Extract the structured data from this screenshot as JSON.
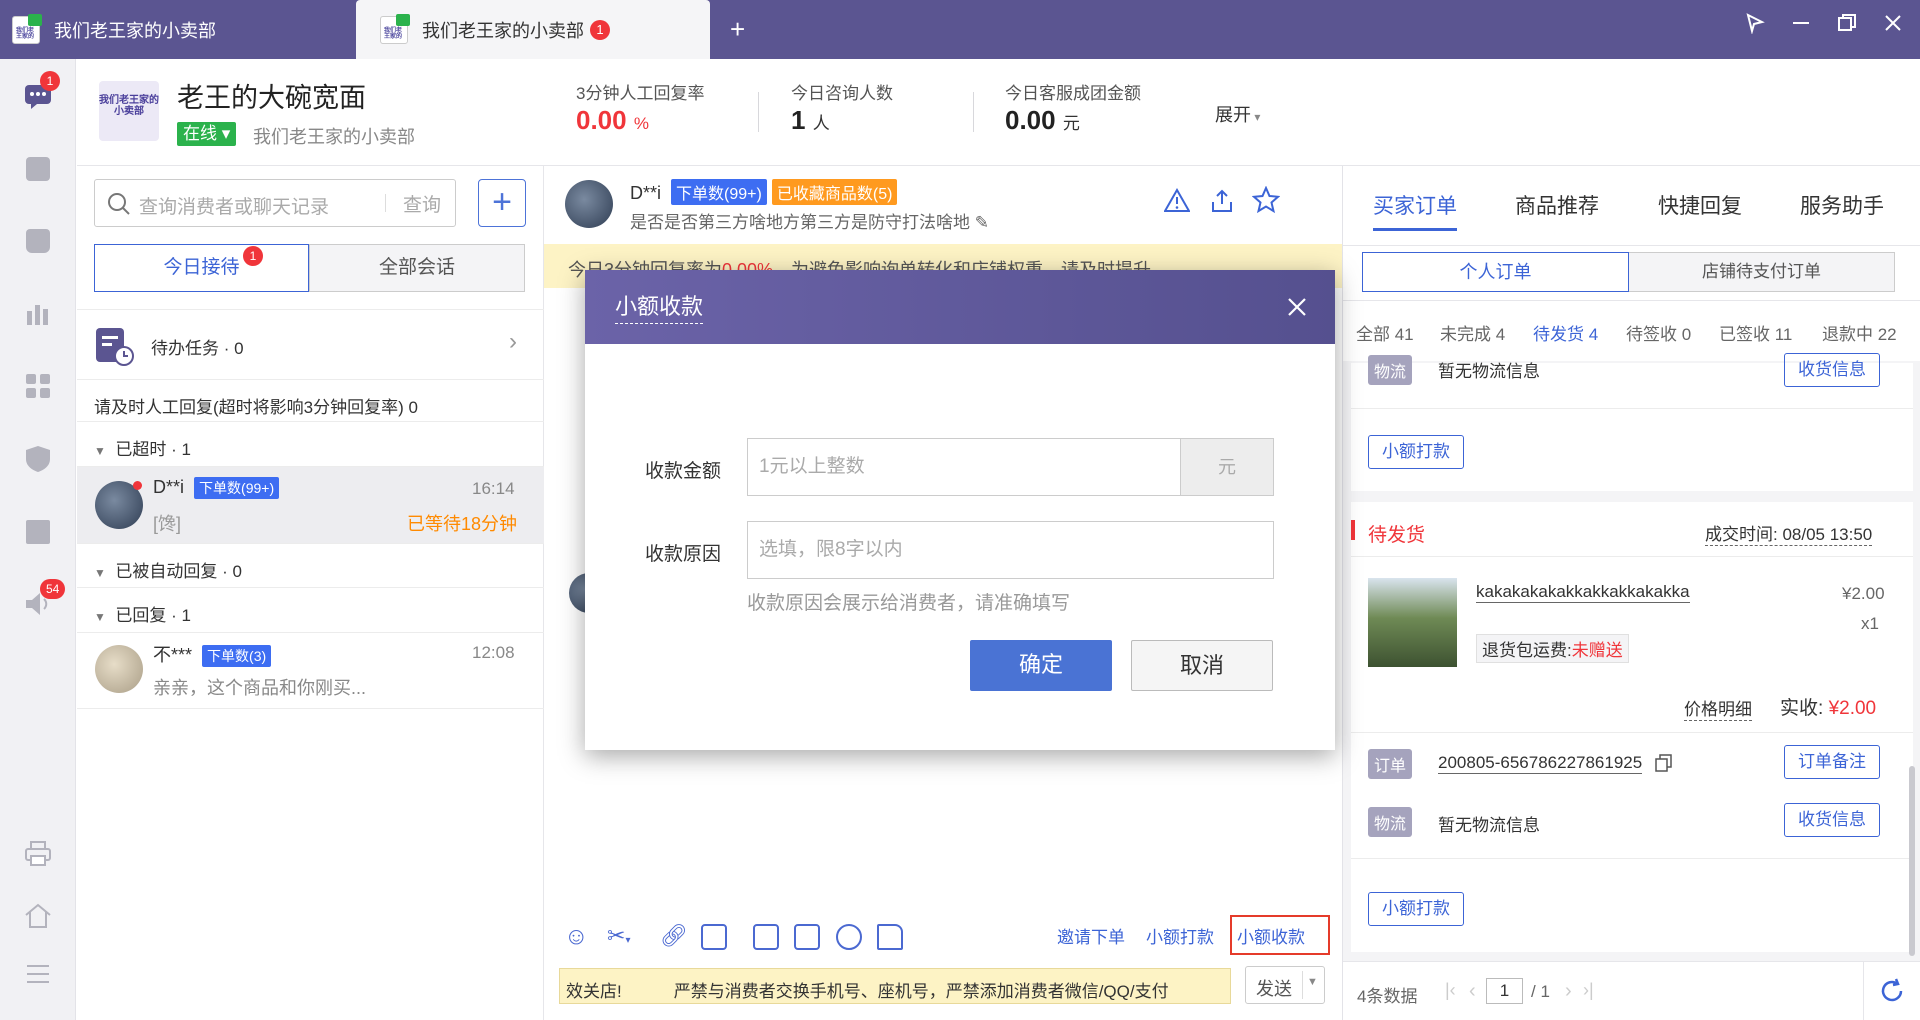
{
  "tabs": [
    {
      "title": "我们老王家的小卖部",
      "active": false
    },
    {
      "title": "我们老王家的小卖部",
      "active": true,
      "badge": "1"
    }
  ],
  "new_tab_symbol": "+",
  "window_icons": [
    "pin-icon",
    "minimize-icon",
    "restore-icon",
    "close-icon"
  ],
  "rail": {
    "chat_badge": "1",
    "notice_badge": "54",
    "icons": [
      "chat-icon",
      "document-icon",
      "bag-icon",
      "bar-chart-icon",
      "apps-icon",
      "shield-icon",
      "book-icon",
      "speaker-icon",
      "printer-icon",
      "home-icon",
      "menu-icon"
    ]
  },
  "header": {
    "logo_text": "我们老王家的小卖部",
    "shop_name": "老王的大碗宽面",
    "status": "在线",
    "store": "我们老王家的小卖部",
    "stats": [
      {
        "label": "3分钟人工回复率",
        "value": "0.00",
        "unit": "%"
      },
      {
        "label": "今日咨询人数",
        "value": "1",
        "unit": "人"
      },
      {
        "label": "今日客服成团金额",
        "value": "0.00",
        "unit": "元"
      }
    ],
    "expand": "展开"
  },
  "convlist": {
    "search_placeholder": "查询消费者或聊天记录",
    "search_button": "查询",
    "add_symbol": "+",
    "seg_today": "今日接待",
    "seg_today_badge": "1",
    "seg_all": "全部会话",
    "todo": "待办任务 · 0",
    "reply_notice": "请及时人工回复(超时将影响3分钟回复率) 0",
    "group_timeout": "已超时 · 1",
    "group_auto": "已被自动回复 · 0",
    "group_replied": "已回复 · 1",
    "items": [
      {
        "name": "D**i",
        "tag": "下单数(99+)",
        "time": "16:14",
        "preview": "[馋]",
        "wait": "已等待18分钟"
      },
      {
        "name": "不***",
        "tag": "下单数(3)",
        "time": "12:08",
        "preview": "亲亲，这个商品和你刚买..."
      }
    ]
  },
  "chat": {
    "name": "D**i",
    "tag_orders": "下单数(99+)",
    "tag_fav": "已收藏商品数(5)",
    "sub": "是否是否第三方啥地方第三方是防守打法啥地",
    "warning": "今日3分钟回复率为",
    "warning_rate": "0.00%",
    "warning_tail": "，为避免影响询单转化和店铺权重，请及时提升",
    "tools": [
      "emoji-icon",
      "scissors-icon",
      "link-icon",
      "image-icon",
      "video-icon",
      "coupon-icon",
      "search-record-icon",
      "folder-icon"
    ],
    "links": [
      "邀请下单",
      "小额打款",
      "小额收款"
    ],
    "notice_left": "效关店!",
    "notice_text": "严禁与消费者交换手机号、座机号，严禁添加消费者微信/QQ/支付",
    "send": "发送"
  },
  "right": {
    "tabs": [
      "买家订单",
      "商品推荐",
      "快捷回复",
      "服务助手"
    ],
    "sub_personal": "个人订单",
    "sub_store": "店铺待支付订单",
    "filters": [
      "全部 41",
      "未完成 4",
      "待发货 4",
      "待签收 0",
      "已签收 11",
      "退款中 22"
    ],
    "top_card": {
      "logistics_tag": "物流",
      "logistics": "暂无物流信息",
      "receive": "收货信息",
      "transfer": "小额打款"
    },
    "order": {
      "status": "待发货",
      "deal_time": "成交时间: 08/05 13:50",
      "product": "kakakakakakkakkakkakakka",
      "price": "¥2.00",
      "qty": "x1",
      "return_label": "退货包运费:",
      "return_val": "未赠送",
      "price_detail": "价格明细",
      "actual_label": "实收:",
      "actual": "¥2.00",
      "order_tag": "订单",
      "order_no": "200805-656786227861925",
      "order_note": "订单备注",
      "logistics_tag": "物流",
      "logistics": "暂无物流信息",
      "receive": "收货信息",
      "transfer": "小额打款"
    },
    "pager": {
      "count": "4条数据",
      "page": "1",
      "total": "/ 1"
    }
  },
  "modal": {
    "title": "小额收款",
    "amount_label": "收款金额",
    "amount_placeholder": "1元以上整数",
    "amount_unit": "元",
    "reason_label": "收款原因",
    "reason_placeholder": "选填，限8字以内",
    "hint": "收款原因会展示给消费者，请准确填写",
    "confirm": "确定",
    "cancel": "取消"
  },
  "colors": {
    "brand": "#5b5591",
    "accent": "#3c64d6",
    "danger": "#f0353a",
    "warn_bg": "#fdf3c5"
  }
}
